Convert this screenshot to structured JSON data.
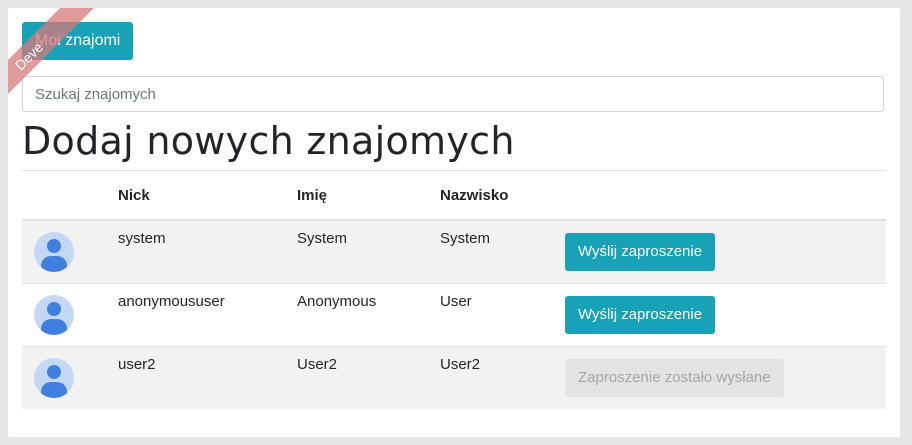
{
  "ribbon": {
    "label": "Deve"
  },
  "header": {
    "my_friends_button": "Moi znajomi"
  },
  "search": {
    "placeholder": "Szukaj znajomych"
  },
  "page": {
    "title": "Dodaj nowych znajomych"
  },
  "table": {
    "headers": {
      "avatar": "",
      "nick": "Nick",
      "first_name": "Imię",
      "last_name": "Nazwisko",
      "action": ""
    },
    "rows": [
      {
        "nick": "system",
        "first_name": "System",
        "last_name": "System",
        "action": "Wyślij zaproszenie",
        "action_state": "enabled"
      },
      {
        "nick": "anonymoususer",
        "first_name": "Anonymous",
        "last_name": "User",
        "action": "Wyślij zaproszenie",
        "action_state": "enabled"
      },
      {
        "nick": "user2",
        "first_name": "User2",
        "last_name": "User2",
        "action": "Zaproszenie zostało wysłane",
        "action_state": "disabled"
      }
    ]
  },
  "icons": {
    "avatar": "user-avatar-icon"
  },
  "colors": {
    "primary_button": "#17a2b8",
    "disabled_button": "#e3e3e3",
    "avatar_bg": "#c4d7f3",
    "avatar_fg": "#3f7fe0",
    "ribbon": "#d77878"
  }
}
